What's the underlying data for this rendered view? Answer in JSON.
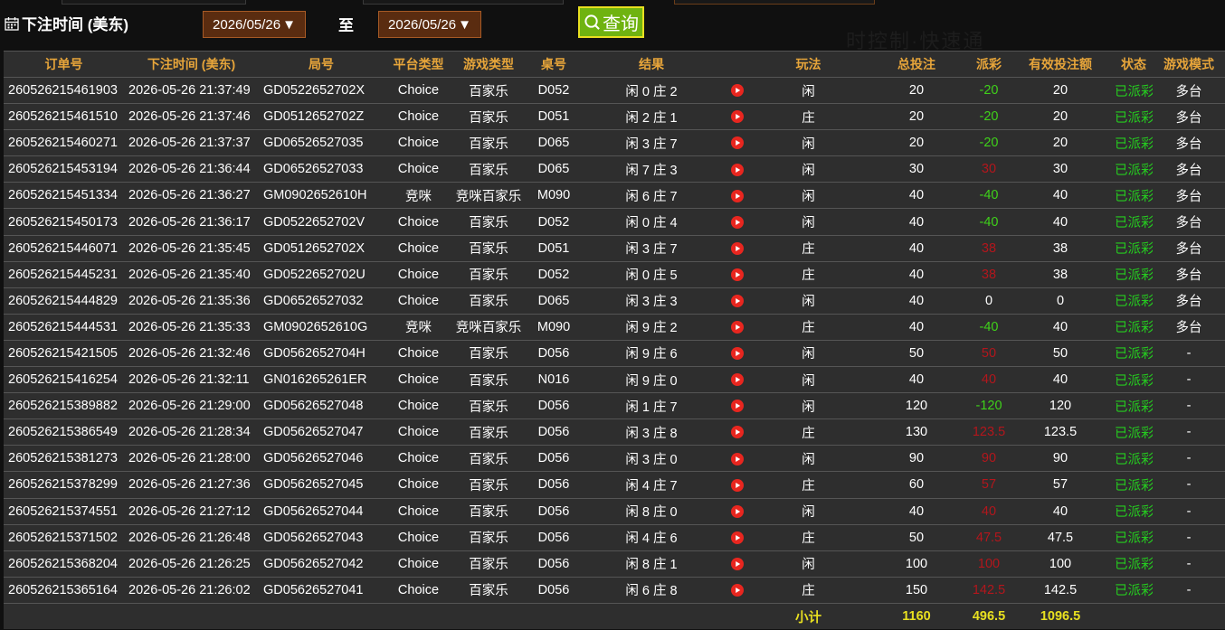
{
  "filter": {
    "label": "下注时间 (美东)",
    "start_date": "2026/05/26",
    "to_label": "至",
    "end_date": "2026/05/26",
    "search_label": "查询",
    "dropdown_glyph": "▼"
  },
  "ghost_text": "时控制·快速通",
  "table": {
    "headers": [
      "订单号",
      "下注时间 (美东)",
      "局号",
      "平台类型",
      "游戏类型",
      "桌号",
      "结果",
      "",
      "玩法",
      "总投注",
      "派彩",
      "有效投注额",
      "状态",
      "游戏模式"
    ],
    "rows": [
      {
        "order": "260526215461903",
        "time": "2026-05-26 21:37:49",
        "round": "GD0522652702X",
        "platform": "Choice",
        "game": "百家乐",
        "table": "D052",
        "result": "闲 0 庄 2",
        "play": "闲",
        "bet": "20",
        "payout": "-20",
        "payout_type": "neg",
        "valid": "20",
        "status": "已派彩",
        "mode": "多台"
      },
      {
        "order": "260526215461510",
        "time": "2026-05-26 21:37:46",
        "round": "GD0512652702Z",
        "platform": "Choice",
        "game": "百家乐",
        "table": "D051",
        "result": "闲 2 庄 1",
        "play": "庄",
        "bet": "20",
        "payout": "-20",
        "payout_type": "neg",
        "valid": "20",
        "status": "已派彩",
        "mode": "多台"
      },
      {
        "order": "260526215460271",
        "time": "2026-05-26 21:37:37",
        "round": "GD06526527035",
        "platform": "Choice",
        "game": "百家乐",
        "table": "D065",
        "result": "闲 3 庄 7",
        "play": "闲",
        "bet": "20",
        "payout": "-20",
        "payout_type": "neg",
        "valid": "20",
        "status": "已派彩",
        "mode": "多台"
      },
      {
        "order": "260526215453194",
        "time": "2026-05-26 21:36:44",
        "round": "GD06526527033",
        "platform": "Choice",
        "game": "百家乐",
        "table": "D065",
        "result": "闲 7 庄 3",
        "play": "闲",
        "bet": "30",
        "payout": "30",
        "payout_type": "pos",
        "valid": "30",
        "status": "已派彩",
        "mode": "多台"
      },
      {
        "order": "260526215451334",
        "time": "2026-05-26 21:36:27",
        "round": "GM0902652610H",
        "platform": "竞咪",
        "game": "竞咪百家乐",
        "table": "M090",
        "result": "闲 6 庄 7",
        "play": "闲",
        "bet": "40",
        "payout": "-40",
        "payout_type": "neg",
        "valid": "40",
        "status": "已派彩",
        "mode": "多台"
      },
      {
        "order": "260526215450173",
        "time": "2026-05-26 21:36:17",
        "round": "GD0522652702V",
        "platform": "Choice",
        "game": "百家乐",
        "table": "D052",
        "result": "闲 0 庄 4",
        "play": "闲",
        "bet": "40",
        "payout": "-40",
        "payout_type": "neg",
        "valid": "40",
        "status": "已派彩",
        "mode": "多台"
      },
      {
        "order": "260526215446071",
        "time": "2026-05-26 21:35:45",
        "round": "GD0512652702X",
        "platform": "Choice",
        "game": "百家乐",
        "table": "D051",
        "result": "闲 3 庄 7",
        "play": "庄",
        "bet": "40",
        "payout": "38",
        "payout_type": "pos",
        "valid": "38",
        "status": "已派彩",
        "mode": "多台"
      },
      {
        "order": "260526215445231",
        "time": "2026-05-26 21:35:40",
        "round": "GD0522652702U",
        "platform": "Choice",
        "game": "百家乐",
        "table": "D052",
        "result": "闲 0 庄 5",
        "play": "庄",
        "bet": "40",
        "payout": "38",
        "payout_type": "pos",
        "valid": "38",
        "status": "已派彩",
        "mode": "多台"
      },
      {
        "order": "260526215444829",
        "time": "2026-05-26 21:35:36",
        "round": "GD06526527032",
        "platform": "Choice",
        "game": "百家乐",
        "table": "D065",
        "result": "闲 3 庄 3",
        "play": "闲",
        "bet": "40",
        "payout": "0",
        "payout_type": "zero",
        "valid": "0",
        "status": "已派彩",
        "mode": "多台"
      },
      {
        "order": "260526215444531",
        "time": "2026-05-26 21:35:33",
        "round": "GM0902652610G",
        "platform": "竞咪",
        "game": "竞咪百家乐",
        "table": "M090",
        "result": "闲 9 庄 2",
        "play": "庄",
        "bet": "40",
        "payout": "-40",
        "payout_type": "neg",
        "valid": "40",
        "status": "已派彩",
        "mode": "多台"
      },
      {
        "order": "260526215421505",
        "time": "2026-05-26 21:32:46",
        "round": "GD0562652704H",
        "platform": "Choice",
        "game": "百家乐",
        "table": "D056",
        "result": "闲 9 庄 6",
        "play": "闲",
        "bet": "50",
        "payout": "50",
        "payout_type": "pos",
        "valid": "50",
        "status": "已派彩",
        "mode": "-"
      },
      {
        "order": "260526215416254",
        "time": "2026-05-26 21:32:11",
        "round": "GN016265261ER",
        "platform": "Choice",
        "game": "百家乐",
        "table": "N016",
        "result": "闲 9 庄 0",
        "play": "闲",
        "bet": "40",
        "payout": "40",
        "payout_type": "pos",
        "valid": "40",
        "status": "已派彩",
        "mode": "-"
      },
      {
        "order": "260526215389882",
        "time": "2026-05-26 21:29:00",
        "round": "GD05626527048",
        "platform": "Choice",
        "game": "百家乐",
        "table": "D056",
        "result": "闲 1 庄 7",
        "play": "闲",
        "bet": "120",
        "payout": "-120",
        "payout_type": "neg",
        "valid": "120",
        "status": "已派彩",
        "mode": "-"
      },
      {
        "order": "260526215386549",
        "time": "2026-05-26 21:28:34",
        "round": "GD05626527047",
        "platform": "Choice",
        "game": "百家乐",
        "table": "D056",
        "result": "闲 3 庄 8",
        "play": "庄",
        "bet": "130",
        "payout": "123.5",
        "payout_type": "pos",
        "valid": "123.5",
        "status": "已派彩",
        "mode": "-"
      },
      {
        "order": "260526215381273",
        "time": "2026-05-26 21:28:00",
        "round": "GD05626527046",
        "platform": "Choice",
        "game": "百家乐",
        "table": "D056",
        "result": "闲 3 庄 0",
        "play": "闲",
        "bet": "90",
        "payout": "90",
        "payout_type": "pos",
        "valid": "90",
        "status": "已派彩",
        "mode": "-"
      },
      {
        "order": "260526215378299",
        "time": "2026-05-26 21:27:36",
        "round": "GD05626527045",
        "platform": "Choice",
        "game": "百家乐",
        "table": "D056",
        "result": "闲 4 庄 7",
        "play": "庄",
        "bet": "60",
        "payout": "57",
        "payout_type": "pos",
        "valid": "57",
        "status": "已派彩",
        "mode": "-"
      },
      {
        "order": "260526215374551",
        "time": "2026-05-26 21:27:12",
        "round": "GD05626527044",
        "platform": "Choice",
        "game": "百家乐",
        "table": "D056",
        "result": "闲 8 庄 0",
        "play": "闲",
        "bet": "40",
        "payout": "40",
        "payout_type": "pos",
        "valid": "40",
        "status": "已派彩",
        "mode": "-"
      },
      {
        "order": "260526215371502",
        "time": "2026-05-26 21:26:48",
        "round": "GD05626527043",
        "platform": "Choice",
        "game": "百家乐",
        "table": "D056",
        "result": "闲 4 庄 6",
        "play": "庄",
        "bet": "50",
        "payout": "47.5",
        "payout_type": "pos",
        "valid": "47.5",
        "status": "已派彩",
        "mode": "-"
      },
      {
        "order": "260526215368204",
        "time": "2026-05-26 21:26:25",
        "round": "GD05626527042",
        "platform": "Choice",
        "game": "百家乐",
        "table": "D056",
        "result": "闲 8 庄 1",
        "play": "闲",
        "bet": "100",
        "payout": "100",
        "payout_type": "pos",
        "valid": "100",
        "status": "已派彩",
        "mode": "-"
      },
      {
        "order": "260526215365164",
        "time": "2026-05-26 21:26:02",
        "round": "GD05626527041",
        "platform": "Choice",
        "game": "百家乐",
        "table": "D056",
        "result": "闲 6 庄 8",
        "play": "庄",
        "bet": "150",
        "payout": "142.5",
        "payout_type": "pos",
        "valid": "142.5",
        "status": "已派彩",
        "mode": "-"
      }
    ],
    "subtotal": {
      "label": "小计",
      "bet": "1160",
      "payout": "496.5",
      "valid": "1096.5"
    }
  },
  "colors": {
    "accent_header": "#e7a53a",
    "win_green": "#3fd11a",
    "loss_red": "#b3161c",
    "status_green": "#25cc1f",
    "subtotal_yellow": "#e8e020",
    "search_bg": "#6fb310",
    "date_bg": "#5a2c10"
  },
  "icons": {
    "calendar": "calendar-icon",
    "search": "search-icon",
    "replay": "play-video-icon"
  }
}
